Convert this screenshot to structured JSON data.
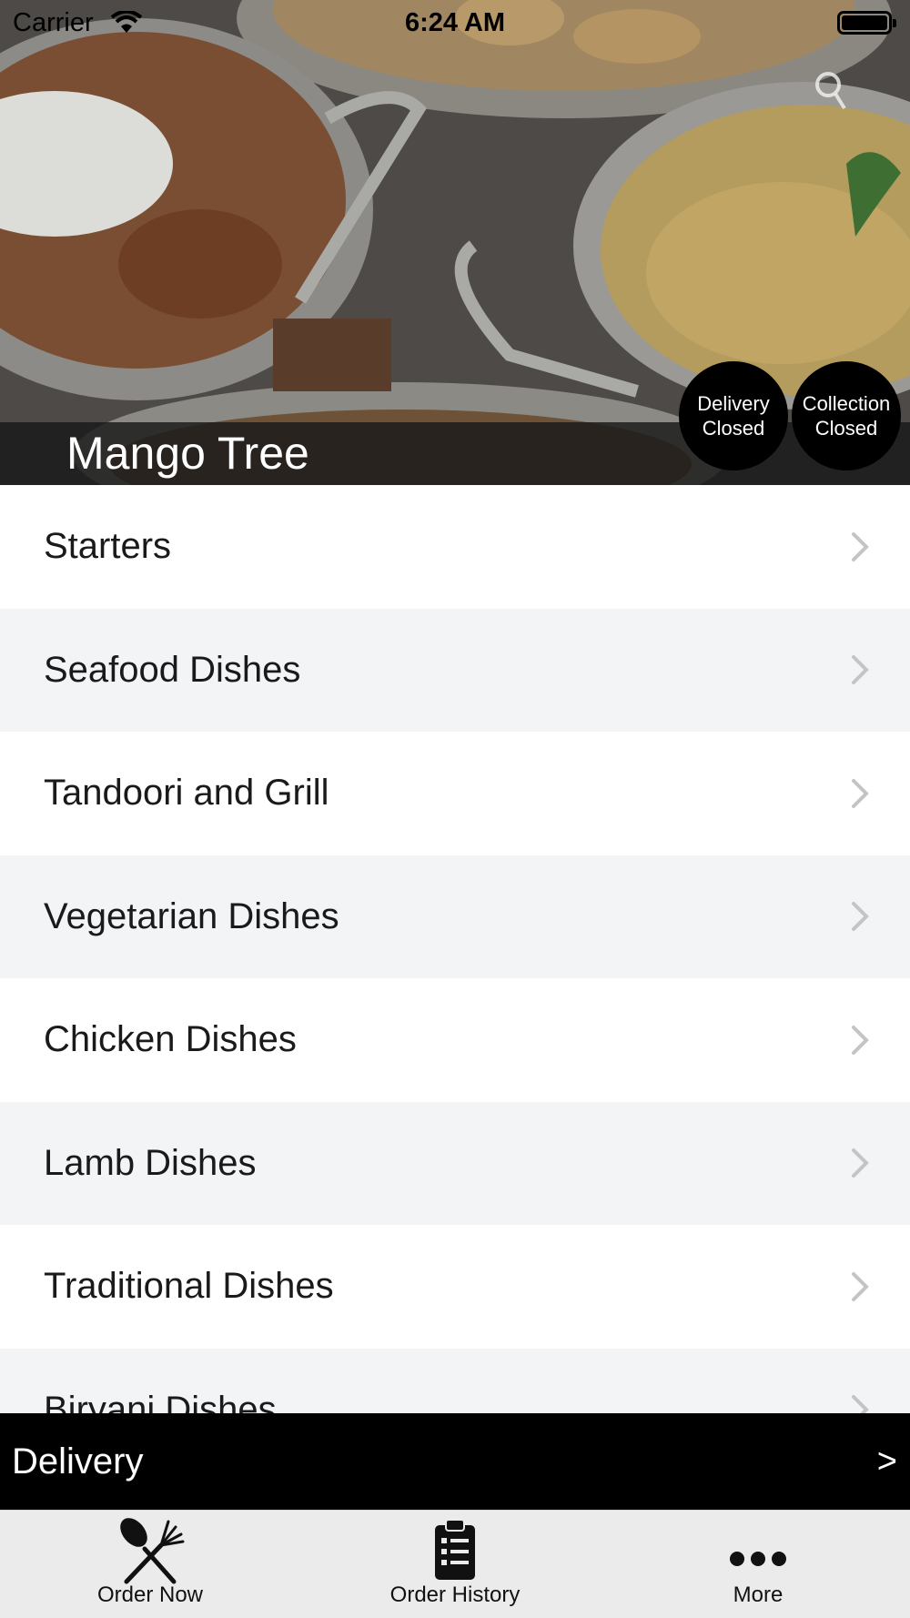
{
  "status_bar": {
    "carrier": "Carrier",
    "time": "6:24 AM"
  },
  "hero": {
    "restaurant_name": "Mango Tree",
    "delivery_badge": {
      "line1": "Delivery",
      "line2": "Closed"
    },
    "collection_badge": {
      "line1": "Collection",
      "line2": "Closed"
    }
  },
  "menu": {
    "categories": [
      "Starters",
      "Seafood Dishes",
      "Tandoori and Grill",
      "Vegetarian Dishes",
      "Chicken Dishes",
      "Lamb Dishes",
      "Traditional Dishes",
      "Biryani Dishes"
    ]
  },
  "order_mode_bar": {
    "label": "Delivery",
    "arrow": ">"
  },
  "tab_bar": {
    "tabs": [
      {
        "label": "Order Now",
        "icon": "fork-knife-icon"
      },
      {
        "label": "Order History",
        "icon": "clipboard-list-icon"
      },
      {
        "label": "More",
        "icon": "more-dots-icon"
      }
    ]
  },
  "colors": {
    "badge_bg": "#000000",
    "row_alt": "#f3f4f6",
    "delivery_bar": "#000000",
    "tab_bar_bg": "#ebebeb"
  }
}
